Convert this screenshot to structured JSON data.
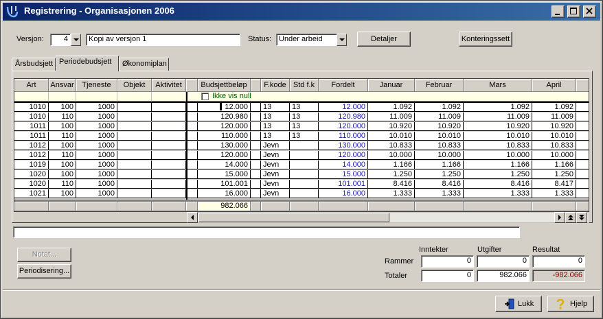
{
  "window": {
    "title": "Registrering - Organisasjonen 2006"
  },
  "titlebar_buttons": {
    "minimize": "_",
    "maximize": "□",
    "close": "✕"
  },
  "top": {
    "versjon_label": "Versjon:",
    "versjon_number": "4",
    "versjon_name": "Kopi av versjon 1",
    "status_label": "Status:",
    "status_value": "Under arbeid",
    "detaljer_label": "Detaljer",
    "konteringssett_label": "Konteringssett"
  },
  "tabs": [
    "Årsbudsjett",
    "Periodebudsjett",
    "Økonomiplan"
  ],
  "grid": {
    "headers": [
      "Art",
      "Ansvar",
      "Tjeneste",
      "Objekt",
      "Aktivitet",
      "Budsjettbeløp",
      "F.kode",
      "Std f.k",
      "Fordelt",
      "Januar",
      "Februar",
      "Mars",
      "April"
    ],
    "filter_label": "Ikke vis null",
    "rows": [
      [
        "1010",
        "100",
        "1000",
        "",
        "",
        "12.000",
        "13",
        "13",
        "12.000",
        "1.092",
        "1.092",
        "1.092",
        "1.092"
      ],
      [
        "1010",
        "110",
        "1000",
        "",
        "",
        "120.980",
        "13",
        "13",
        "120.980",
        "11.009",
        "11.009",
        "11.009",
        "11.009"
      ],
      [
        "1011",
        "100",
        "1000",
        "",
        "",
        "120.000",
        "13",
        "13",
        "120.000",
        "10.920",
        "10.920",
        "10.920",
        "10.920"
      ],
      [
        "1011",
        "110",
        "1000",
        "",
        "",
        "110.000",
        "13",
        "13",
        "110.000",
        "10.010",
        "10.010",
        "10.010",
        "10.010"
      ],
      [
        "1012",
        "100",
        "1000",
        "",
        "",
        "130.000",
        "Jevn",
        "",
        "130.000",
        "10.833",
        "10.833",
        "10.833",
        "10.833"
      ],
      [
        "1012",
        "110",
        "1000",
        "",
        "",
        "120.000",
        "Jevn",
        "",
        "120.000",
        "10.000",
        "10.000",
        "10.000",
        "10.000"
      ],
      [
        "1019",
        "100",
        "1000",
        "",
        "",
        "14.000",
        "Jevn",
        "",
        "14.000",
        "1.166",
        "1.166",
        "1.166",
        "1.166"
      ],
      [
        "1020",
        "100",
        "1000",
        "",
        "",
        "15.000",
        "Jevn",
        "",
        "15.000",
        "1.250",
        "1.250",
        "1.250",
        "1.250"
      ],
      [
        "1020",
        "110",
        "1000",
        "",
        "",
        "101.001",
        "Jevn",
        "",
        "101.001",
        "8.416",
        "8.416",
        "8.416",
        "8.417"
      ],
      [
        "1021",
        "100",
        "1000",
        "",
        "",
        "16.000",
        "Jevn",
        "",
        "16.000",
        "1.333",
        "1.333",
        "1.333",
        "1.333"
      ]
    ],
    "sum_budsjett": "982.066"
  },
  "buttons": {
    "notat": "Notat...",
    "periodisering": "Periodisering...",
    "lukk": "Lukk",
    "hjelp": "Hjelp"
  },
  "summary": {
    "col_inntekter": "Inntekter",
    "col_utgifter": "Utgifter",
    "col_resultat": "Resultat",
    "rammer_label": "Rammer",
    "totaler_label": "Totaler",
    "rammer": [
      "0",
      "0",
      "0"
    ],
    "totaler": [
      "0",
      "982.066",
      "-982.066"
    ]
  },
  "colors": {
    "title_start": "#0a246a",
    "title_end": "#3a6ea5",
    "blue_values": "#1a1aa8",
    "negative": "#8b0000",
    "filter_row": "#ffffe6"
  }
}
